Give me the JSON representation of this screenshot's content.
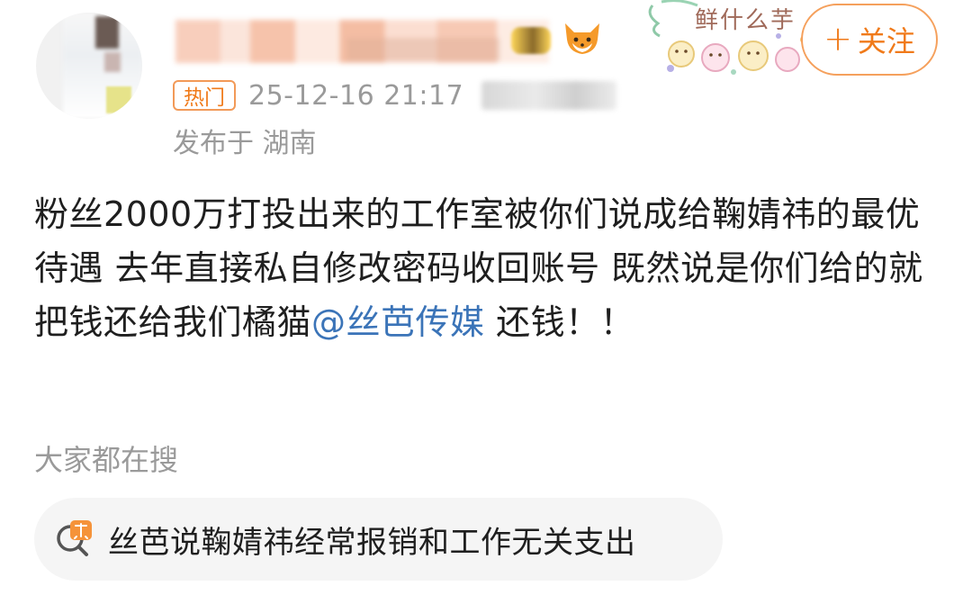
{
  "header": {
    "follow_button": {
      "icon": "plus-icon",
      "label": "关注"
    },
    "hot_tag": "热门",
    "timestamp": "25-12-16 21:17",
    "location": "发布于 湖南",
    "decoration_text": "鲜什么芋"
  },
  "post": {
    "text_before_mention": "粉丝2000万打投出来的工作室被你们说成给鞠婧祎的最优待遇 去年直接私自修改密码收回账号 既然说是你们给的就把钱还给我们橘猫",
    "mention": "@丝芭传媒",
    "text_after_mention": " 还钱！！"
  },
  "search_section": {
    "heading": "大家都在搜",
    "items": [
      {
        "icon": "hot-search-icon",
        "label": "丝芭说鞠婧祎经常报销和工作无关支出"
      }
    ]
  },
  "colors": {
    "accent_orange": "#f07a1a",
    "mention_blue": "#3b74b8",
    "meta_gray": "#9a9a9a",
    "chip_background": "#f5f5f5"
  }
}
